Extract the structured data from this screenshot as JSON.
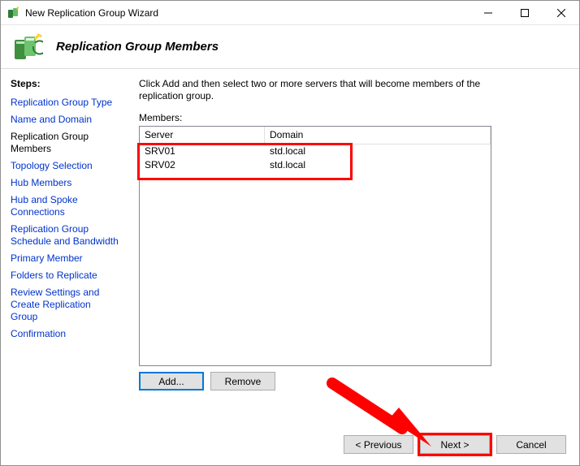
{
  "window": {
    "title": "New Replication Group Wizard"
  },
  "header": {
    "title": "Replication Group Members"
  },
  "sidebar": {
    "heading": "Steps:",
    "items": [
      "Replication Group Type",
      "Name and Domain",
      "Replication Group Members",
      "Topology Selection",
      "Hub Members",
      "Hub and Spoke Connections",
      "Replication Group Schedule and Bandwidth",
      "Primary Member",
      "Folders to Replicate",
      "Review Settings and Create Replication Group",
      "Confirmation"
    ],
    "current_index": 2
  },
  "main": {
    "instructions": "Click Add and then select two or more servers that will become members of the replication group.",
    "members_label": "Members:",
    "columns": {
      "server": "Server",
      "domain": "Domain"
    },
    "rows": [
      {
        "server": "SRV01",
        "domain": "std.local"
      },
      {
        "server": "SRV02",
        "domain": "std.local"
      }
    ],
    "btn_add": "Add...",
    "btn_remove": "Remove"
  },
  "footer": {
    "previous": "< Previous",
    "next": "Next >",
    "cancel": "Cancel"
  }
}
